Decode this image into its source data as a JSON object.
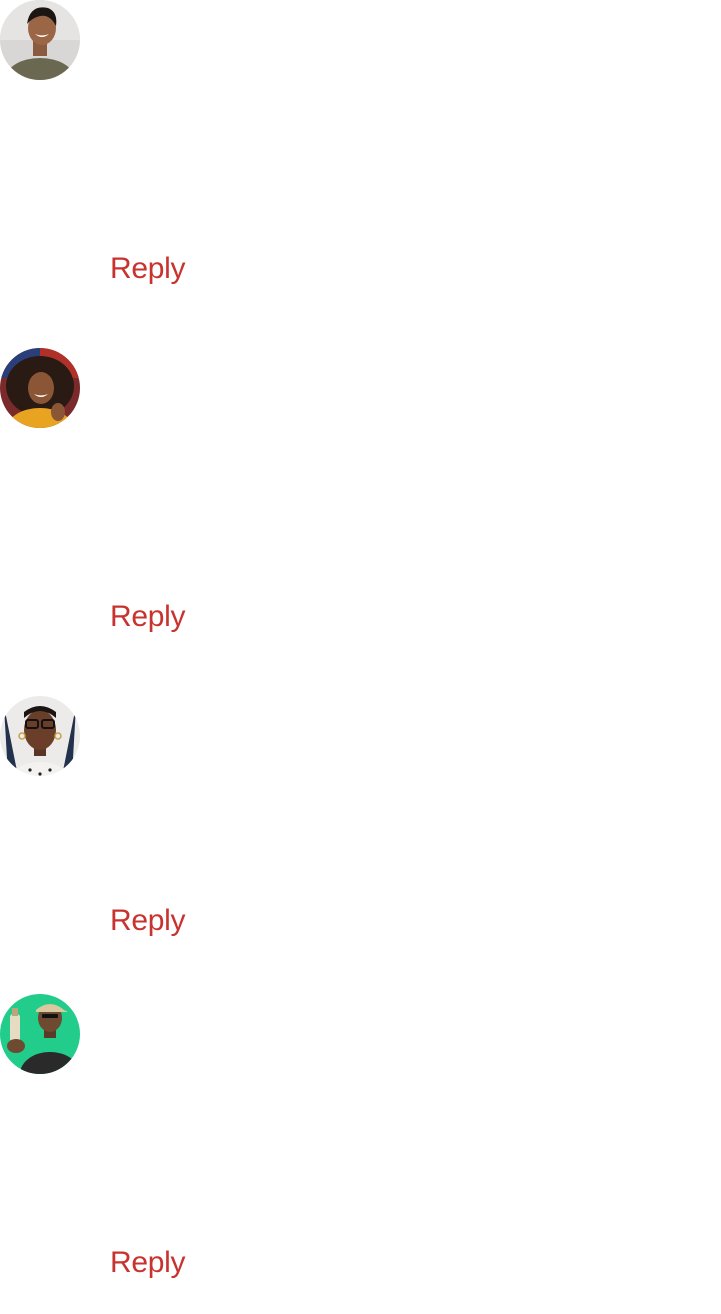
{
  "accent_color": "#c8332f",
  "comments": [
    {
      "avatar": "avatar-woman-short-hair",
      "reply_label": "Reply"
    },
    {
      "avatar": "avatar-woman-curly-hair",
      "reply_label": "Reply"
    },
    {
      "avatar": "avatar-woman-glasses",
      "reply_label": "Reply"
    },
    {
      "avatar": "avatar-man-cap",
      "reply_label": "Reply"
    }
  ]
}
